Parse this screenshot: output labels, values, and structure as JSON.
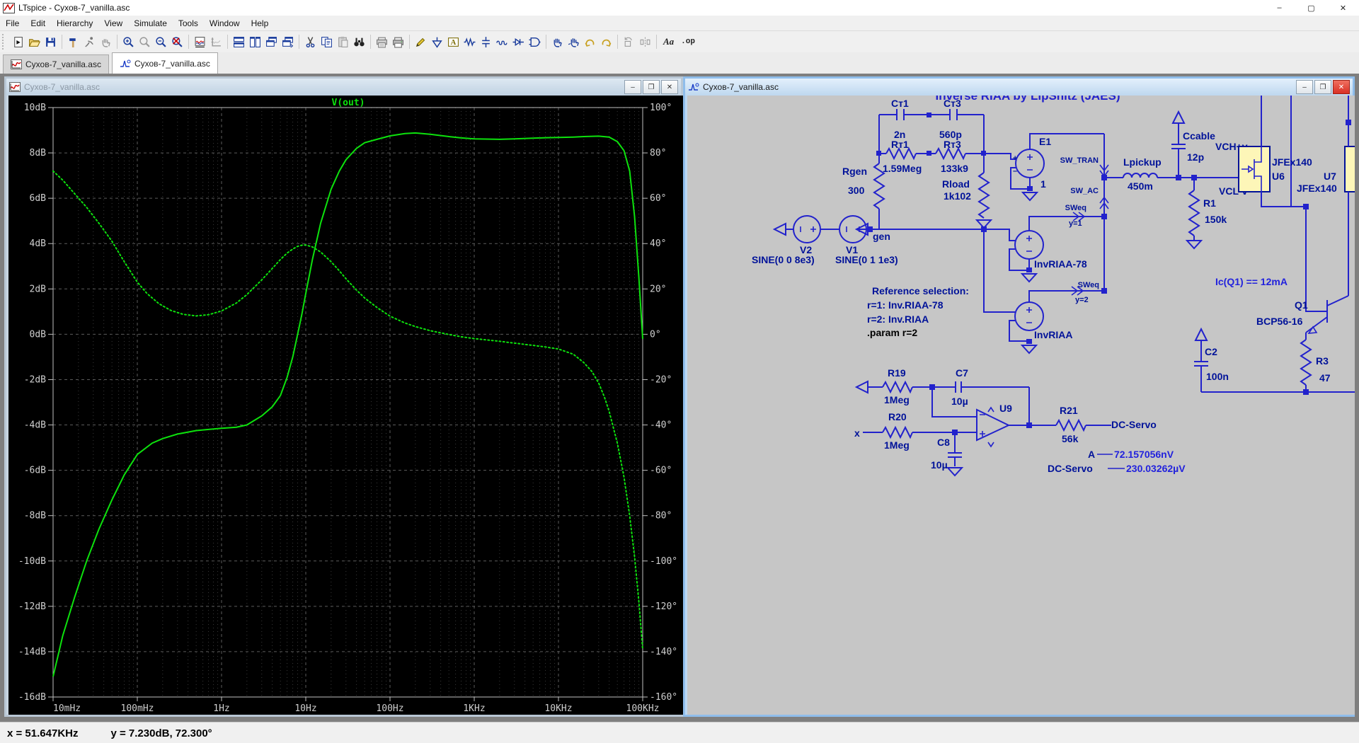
{
  "app": {
    "title": "LTspice - Сухов-7_vanilla.asc",
    "controls": {
      "minimize": "–",
      "maximize": "▢",
      "close": "✕"
    }
  },
  "menu": {
    "items": [
      "File",
      "Edit",
      "Hierarchy",
      "View",
      "Simulate",
      "Tools",
      "Window",
      "Help"
    ]
  },
  "toolbar": {
    "icons": [
      "new-schematic",
      "open-file",
      "save",
      "control-panel",
      "run",
      "halt",
      "zoom-in",
      "zoom-back",
      "zoom-out",
      "zoom-fit",
      "autorange-y",
      "plot-settings",
      "tile-horizontal",
      "tile-vertical",
      "cascade",
      "overlap-windows",
      "cut",
      "copy",
      "paste",
      "find",
      "print-preview",
      "print",
      "wire",
      "ground",
      "label",
      "resistor",
      "capacitor",
      "inductor",
      "diode",
      "component",
      "move",
      "drag",
      "undo",
      "redo",
      "rotate",
      "mirror"
    ],
    "text_tool": "Aa",
    "directive_tool": ".op"
  },
  "tabs": [
    {
      "label": "Сухов-7_vanilla.asc",
      "type": "waveform",
      "active": false
    },
    {
      "label": "Сухов-7_vanilla.asc",
      "type": "schematic",
      "active": true
    }
  ],
  "plot_window": {
    "title": "Сухов-7_vanilla.asc",
    "controls": {
      "minimize": "–",
      "restore": "❐",
      "close": "✕"
    }
  },
  "chart_data": {
    "type": "line",
    "title": "V(out)",
    "x_scale": "log",
    "x_range_hz": [
      0.01,
      100000
    ],
    "x_ticks": [
      "10mHz",
      "100mHz",
      "1Hz",
      "10Hz",
      "100Hz",
      "1KHz",
      "10KHz",
      "100KHz"
    ],
    "left_axis": {
      "unit": "dB",
      "range": [
        -16,
        10
      ],
      "step": 2,
      "ticks": [
        "10dB",
        "8dB",
        "6dB",
        "4dB",
        "2dB",
        "0dB",
        "-2dB",
        "-4dB",
        "-6dB",
        "-8dB",
        "-10dB",
        "-12dB",
        "-14dB",
        "-16dB"
      ]
    },
    "right_axis": {
      "unit": "degrees",
      "range": [
        -160,
        100
      ],
      "step": 20,
      "ticks": [
        "100°",
        "80°",
        "60°",
        "40°",
        "20°",
        "0°",
        "-20°",
        "-40°",
        "-60°",
        "-80°",
        "-100°",
        "-120°",
        "-140°",
        "-160°"
      ]
    },
    "color": "#0de20d",
    "grid": true,
    "series": [
      {
        "name": "V(out) magnitude",
        "axis": "left",
        "unit": "dB",
        "style": "solid",
        "points": [
          [
            0.01,
            -15.1
          ],
          [
            0.013,
            -13.3
          ],
          [
            0.018,
            -11.6
          ],
          [
            0.025,
            -10.0
          ],
          [
            0.035,
            -8.6
          ],
          [
            0.05,
            -7.3
          ],
          [
            0.07,
            -6.2
          ],
          [
            0.1,
            -5.3
          ],
          [
            0.15,
            -4.8
          ],
          [
            0.2,
            -4.6
          ],
          [
            0.3,
            -4.4
          ],
          [
            0.5,
            -4.25
          ],
          [
            0.7,
            -4.2
          ],
          [
            1,
            -4.15
          ],
          [
            1.5,
            -4.1
          ],
          [
            2,
            -4.0
          ],
          [
            3,
            -3.6
          ],
          [
            4,
            -3.2
          ],
          [
            5,
            -2.7
          ],
          [
            6,
            -1.9
          ],
          [
            7,
            -1.0
          ],
          [
            8,
            0.0
          ],
          [
            9,
            0.9
          ],
          [
            10,
            1.8
          ],
          [
            12,
            3.3
          ],
          [
            15,
            4.9
          ],
          [
            20,
            6.4
          ],
          [
            25,
            7.2
          ],
          [
            30,
            7.7
          ],
          [
            40,
            8.2
          ],
          [
            50,
            8.45
          ],
          [
            70,
            8.6
          ],
          [
            100,
            8.75
          ],
          [
            150,
            8.85
          ],
          [
            200,
            8.88
          ],
          [
            300,
            8.82
          ],
          [
            500,
            8.72
          ],
          [
            700,
            8.66
          ],
          [
            1000,
            8.62
          ],
          [
            2000,
            8.6
          ],
          [
            3000,
            8.62
          ],
          [
            5000,
            8.65
          ],
          [
            7000,
            8.67
          ],
          [
            10000,
            8.68
          ],
          [
            15000,
            8.7
          ],
          [
            20000,
            8.72
          ],
          [
            30000,
            8.74
          ],
          [
            40000,
            8.7
          ],
          [
            50000,
            8.5
          ],
          [
            60000,
            8.1
          ],
          [
            70000,
            7.2
          ],
          [
            80000,
            5.2
          ],
          [
            90000,
            2.5
          ],
          [
            100000,
            -0.2
          ]
        ]
      },
      {
        "name": "V(out) phase",
        "axis": "right",
        "unit": "deg",
        "style": "dotted",
        "points": [
          [
            0.01,
            72
          ],
          [
            0.013,
            68
          ],
          [
            0.018,
            62
          ],
          [
            0.025,
            56
          ],
          [
            0.035,
            49
          ],
          [
            0.05,
            41
          ],
          [
            0.07,
            32
          ],
          [
            0.1,
            23
          ],
          [
            0.13,
            18
          ],
          [
            0.18,
            13.5
          ],
          [
            0.25,
            10.5
          ],
          [
            0.35,
            8.8
          ],
          [
            0.5,
            8.1
          ],
          [
            0.7,
            8.6
          ],
          [
            1,
            10.3
          ],
          [
            1.5,
            13.8
          ],
          [
            2,
            17.5
          ],
          [
            3,
            24
          ],
          [
            4,
            29
          ],
          [
            5,
            33
          ],
          [
            6,
            35.8
          ],
          [
            7,
            37.6
          ],
          [
            8,
            38.8
          ],
          [
            9,
            39.3
          ],
          [
            10,
            39.4
          ],
          [
            12,
            38.5
          ],
          [
            15,
            36.3
          ],
          [
            20,
            32
          ],
          [
            25,
            28
          ],
          [
            30,
            24.5
          ],
          [
            40,
            19.5
          ],
          [
            50,
            16
          ],
          [
            70,
            11.8
          ],
          [
            100,
            8
          ],
          [
            150,
            5
          ],
          [
            200,
            3.4
          ],
          [
            300,
            1.6
          ],
          [
            500,
            -0.1
          ],
          [
            700,
            -1.1
          ],
          [
            1000,
            -1.9
          ],
          [
            2000,
            -3.1
          ],
          [
            3000,
            -3.9
          ],
          [
            5000,
            -4.9
          ],
          [
            7000,
            -5.6
          ],
          [
            10000,
            -6.5
          ],
          [
            15000,
            -8.8
          ],
          [
            20000,
            -12.5
          ],
          [
            25000,
            -16.5
          ],
          [
            30000,
            -21.5
          ],
          [
            35000,
            -27.5
          ],
          [
            40000,
            -34
          ],
          [
            50000,
            -48
          ],
          [
            60000,
            -63
          ],
          [
            70000,
            -80
          ],
          [
            80000,
            -98
          ],
          [
            90000,
            -118
          ],
          [
            100000,
            -139
          ]
        ]
      }
    ]
  },
  "schematic_window": {
    "title": "Сухов-7_vanilla.asc",
    "controls": {
      "minimize": "–",
      "restore": "❐",
      "close": "✕"
    },
    "labels": {
      "header": "Inverse RIAA by LipShitz (JAES)",
      "ct1_name": "Cт1",
      "ct1_val": "2n",
      "ct3_name": "Cт3",
      "ct3_val": "560p",
      "rt1_name": "Rт1",
      "rt1_val": "1.59Meg",
      "rt3_name": "Rт3",
      "rt3_val": "133k9",
      "rgen_name": "Rgen",
      "rgen_val": "300",
      "rload_name": "Rload",
      "rload_val": "1k102",
      "e1_name": "E1",
      "e1_val": "1",
      "sw_tran": "SW_TRAN",
      "sw_ac": "SW_AC",
      "sweq1": "SWeq",
      "sweq1_cond": "y=1",
      "sweq2": "SWeq",
      "sweq2_cond": "y=2",
      "lpickup_name": "Lpickup",
      "lpickup_val": "450m",
      "v2_name": "V2",
      "v2_val": "SINE(0 0 8e3)",
      "v1_name": "V1",
      "v1_val": "SINE(0 1 1e3)",
      "gen_node": "gen",
      "ref_title": "Reference selection:",
      "ref_r1": "r=1: Inv.RIAA-78",
      "ref_r2": "r=2: Inv.RIAA",
      "param_directive": ".param r=2",
      "invriaa78_name": "InvRIAA-78",
      "invriaa_name": "InvRIAA",
      "ccable_name": "Ccable",
      "ccable_val": "12p",
      "vch_node": "VCH+v",
      "vcl_node": "VCL-v",
      "u6_name": "U6",
      "u6_type": "JFEx140",
      "u7_name": "U7",
      "u7_type": "JFEx140",
      "r1_name": "R1",
      "r1_val": "150k",
      "ic_note": "Ic(Q1) == 12mA",
      "q1_name": "Q1",
      "q1_type": "BCP56-16",
      "c2_name": "C2",
      "c2_val": "100n",
      "r3_name": "R3",
      "r3_val": "47",
      "r19_name": "R19",
      "r19_val": "1Meg",
      "r20_name": "R20",
      "r20_val": "1Meg",
      "c7_name": "C7",
      "c7_val": "10µ",
      "c8_name": "C8",
      "c8_val": "10µ",
      "u9_name": "U9",
      "r21_name": "R21",
      "r21_val": "56k",
      "x_node": "x",
      "dcservo_node": "DC-Servo",
      "meas_a_name": "A",
      "meas_a_val": "72.157056nV",
      "meas_dc_name": "DC-Servo",
      "meas_dc_val": "230.03262µV"
    }
  },
  "status_bar": {
    "x_readout": "x = 51.647KHz",
    "y_readout": "y = 7.230dB, 72.300°"
  }
}
